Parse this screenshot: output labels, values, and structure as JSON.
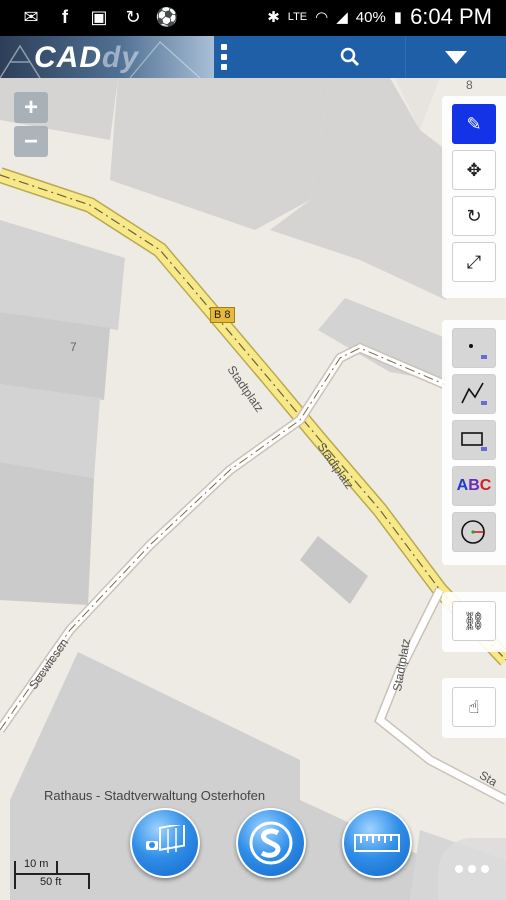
{
  "status_bar": {
    "left_icons": [
      "message-icon",
      "facebook-icon",
      "store-icon",
      "sync-icon",
      "soccer-icon"
    ],
    "network": "LTE",
    "battery": "40%",
    "time": "6:04 PM"
  },
  "app_bar": {
    "logo_text_main": "CAD",
    "logo_text_accent": "dy",
    "icons": [
      "menu-icon",
      "search-icon",
      "dropdown-icon"
    ]
  },
  "map": {
    "labels": {
      "road_b8": "B 8",
      "stadtplatz_1": "Stadtplatz",
      "stadtplatz_2": "Stadtplatz",
      "stadtplatz_3": "Stadtplatz",
      "stadtplatz_4": "Sta",
      "seewiesen": "Seewiesen",
      "house_7": "7",
      "house_8": "8",
      "rathaus": "Rathaus - Stadtverwaltung Osterhofen"
    },
    "colors": {
      "road_primary": "#f7e98a",
      "building": "#d3d3d3",
      "background": "#eeeae4"
    }
  },
  "zoom": {
    "in": "+",
    "out": "−"
  },
  "tools_top": [
    {
      "name": "edit",
      "glyph": "✎",
      "active": true
    },
    {
      "name": "move",
      "glyph": "✥",
      "active": false
    },
    {
      "name": "rotate",
      "glyph": "↻",
      "active": false
    },
    {
      "name": "scale",
      "glyph": "⤢",
      "active": false
    }
  ],
  "tools_draw": [
    {
      "name": "point",
      "glyph": "·"
    },
    {
      "name": "polyline",
      "glyph": ""
    },
    {
      "name": "rectangle",
      "glyph": ""
    },
    {
      "name": "text",
      "glyph": "ABC"
    },
    {
      "name": "circle",
      "glyph": ""
    }
  ],
  "tools_bottom": [
    {
      "name": "link",
      "glyph": "⛓"
    },
    {
      "name": "hand",
      "glyph": "☝"
    }
  ],
  "scale": {
    "meters": "10 m",
    "feet": "50 ft"
  },
  "bottom_buttons": [
    "satellite-icon",
    "s-logo-icon",
    "ruler-icon"
  ]
}
